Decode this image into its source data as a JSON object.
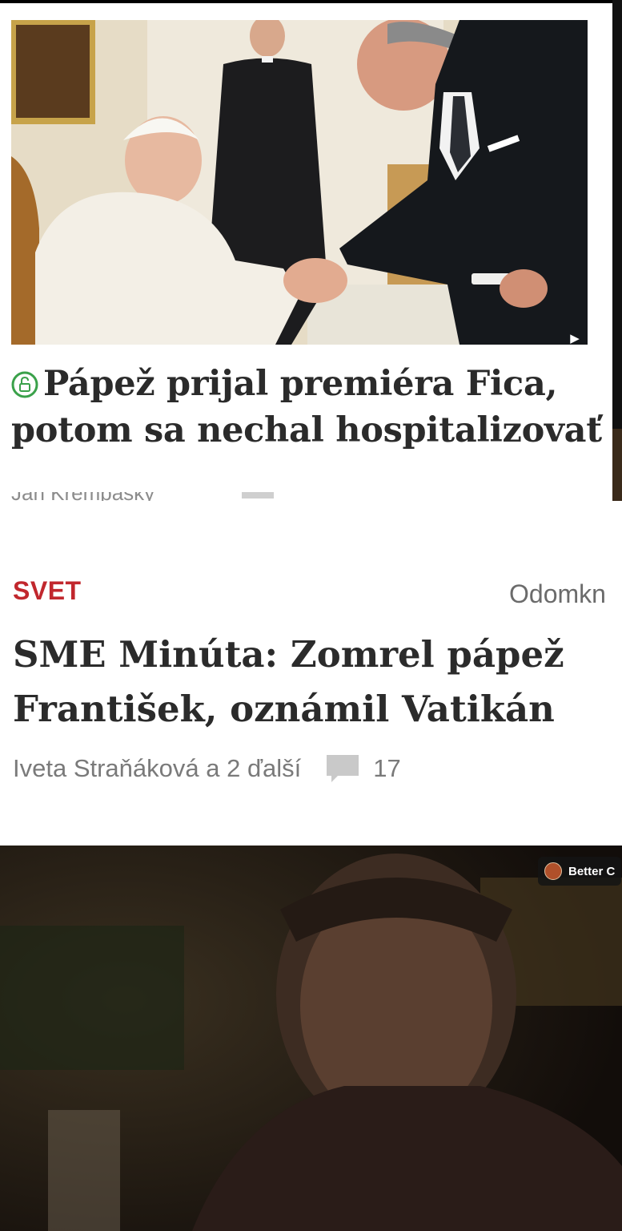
{
  "article_top": {
    "headline": "Pápež prijal premiéra Fica, potom sa nechal hospitalizovať",
    "author": "Ján Krempaský",
    "play_icon": "play-icon",
    "lock_icon": "lock-icon"
  },
  "article_main": {
    "section": "SVET",
    "unlock_label": "Odomkn",
    "headline": "SME Minúta: Zomrel pápež František, oznámil Vatikán",
    "authors": "Iveta Straňáková a 2 ďalší",
    "comment_count": "17",
    "comment_icon": "comment-icon"
  },
  "video": {
    "channel": "Better C"
  },
  "colors": {
    "section_red": "#c1272d",
    "headline_text": "#2b2b2b",
    "lock_green": "#3aa14a",
    "muted_text": "#7a7a7a"
  }
}
